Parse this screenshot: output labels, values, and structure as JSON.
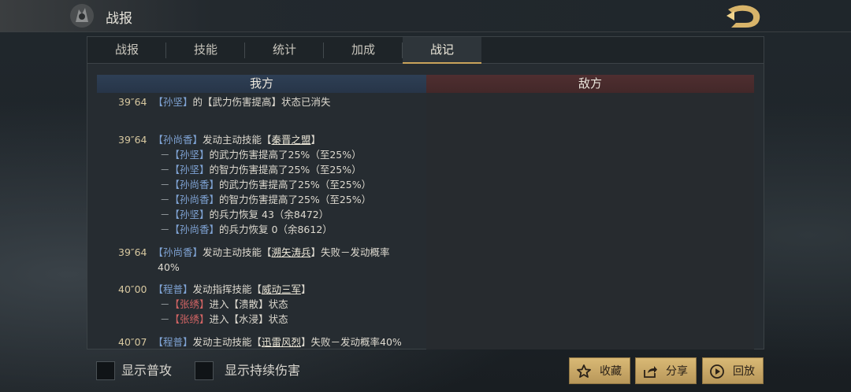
{
  "header": {
    "title": "战报"
  },
  "tabs": [
    "战报",
    "技能",
    "统计",
    "加成",
    "战记"
  ],
  "active_tab": "战记",
  "columns": {
    "mine": "我方",
    "enemy": "敌方"
  },
  "log": {
    "e1": {
      "time": "39″64",
      "who": "【孙坚】",
      "rest": "的【武力伤害提高】状态已消失"
    },
    "e2": {
      "time": "39″64",
      "who": "【孙尚香】",
      "pre": "发动主动技能【",
      "skill": "秦晋之盟",
      "post": "】"
    },
    "e2s": [
      {
        "who": "【孙坚】",
        "rest": "的武力伤害提高了25%（至25%）"
      },
      {
        "who": "【孙坚】",
        "rest": "的智力伤害提高了25%（至25%）"
      },
      {
        "who": "【孙尚香】",
        "rest": "的武力伤害提高了25%（至25%）"
      },
      {
        "who": "【孙尚香】",
        "rest": "的智力伤害提高了25%（至25%）"
      },
      {
        "who": "【孙坚】",
        "rest": "的兵力恢复 43（余8472）"
      },
      {
        "who": "【孙尚香】",
        "rest": "的兵力恢复 0（余8612）"
      }
    ],
    "e3": {
      "time": "39″64",
      "who": "【孙尚香】",
      "pre": "发动主动技能【",
      "skill": "溯矢涛兵",
      "post": "】失败－发动概率",
      "wrap": "40%"
    },
    "e4": {
      "time": "40″00",
      "who": "【程普】",
      "pre": "发动指挥技能【",
      "skill": "威动三军",
      "post": "】"
    },
    "e4s": [
      {
        "who": "【张绣】",
        "pre": "进入【",
        "state": "溃散",
        "post": "】状态"
      },
      {
        "who": "【张绣】",
        "pre": "进入【",
        "state": "水浸",
        "post": "】状态"
      }
    ],
    "e5": {
      "time": "40″07",
      "who": "【程普】",
      "pre": "发动主动技能【",
      "skill": "迅雷风烈",
      "post": "】失败－发动概率40%"
    }
  },
  "dash": "－",
  "footer": {
    "show_normal_attack": "显示普攻",
    "show_dot": "显示持续伤害",
    "buttons": {
      "favorite": "收藏",
      "share": "分享",
      "replay": "回放"
    }
  },
  "icons": {
    "favorite": "star-icon",
    "share": "share-icon",
    "replay": "play-icon",
    "back": "back-icon"
  },
  "colors": {
    "accent": "#c9a35a",
    "ally_name": "#7fa3d4",
    "enemy_name": "#d26464"
  }
}
